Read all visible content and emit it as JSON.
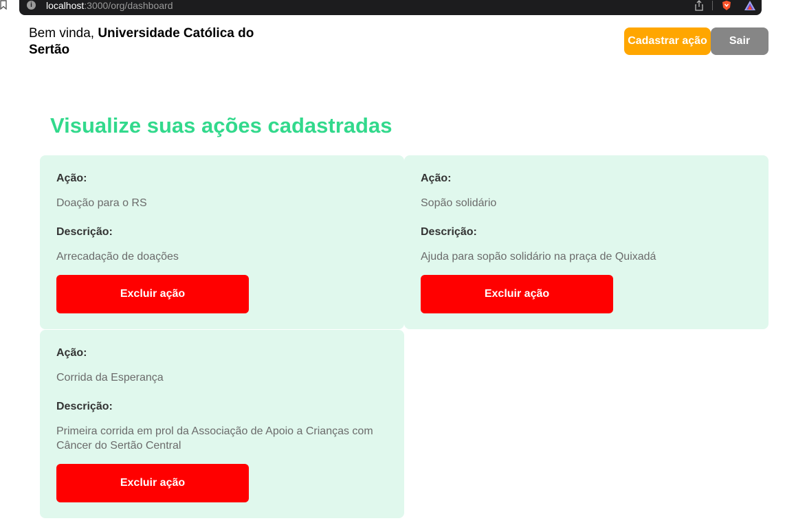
{
  "browser": {
    "url_host": "localhost",
    "url_rest": ":3000/org/dashboard"
  },
  "header": {
    "greeting": "Bem vinda,",
    "org_name": "Universidade Católica do Sertão",
    "register_button": "Cadastrar ação",
    "logout_button": "Sair"
  },
  "main": {
    "title": "Visualize suas ações cadastradas",
    "action_label": "Ação:",
    "description_label": "Descrição:",
    "delete_button": "Excluir ação",
    "actions": [
      {
        "name": "Doação para o RS",
        "description": "Arrecadação de doações"
      },
      {
        "name": "Sopão solidário",
        "description": "Ajuda para sopão solidário na praça de Quixadá"
      },
      {
        "name": "Corrida da Esperança",
        "description": "Primeira corrida em prol da Associação de Apoio a Crianças com Câncer do Sertão Central"
      }
    ]
  },
  "colors": {
    "accent_green": "#32d98c",
    "card_background": "#e0f8ed",
    "register_orange": "#ffa600",
    "logout_gray": "#868686",
    "delete_red": "#ff0000"
  },
  "icons": [
    "bookmark-icon",
    "site-info-icon",
    "share-icon",
    "brave-shield-icon",
    "brave-rewards-icon"
  ]
}
